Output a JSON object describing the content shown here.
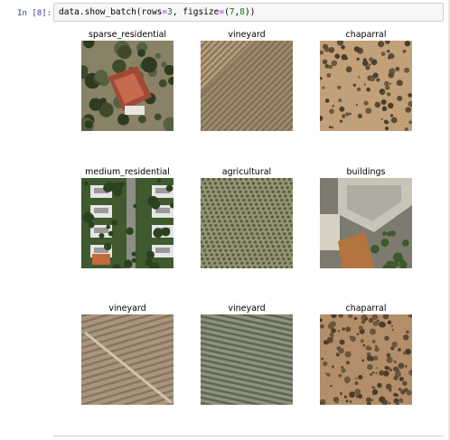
{
  "cell": {
    "prompt": "In [8]:",
    "code_parts": [
      "data.show_batch(rows",
      "=",
      "3",
      ", figsize",
      "=",
      "(",
      "7",
      ",",
      "8",
      "))"
    ]
  },
  "grid": {
    "rows": 3,
    "cols": 3,
    "images": [
      {
        "label": "sparse_residential",
        "kind": "residential-sparse"
      },
      {
        "label": "vineyard",
        "kind": "vineyard-diag"
      },
      {
        "label": "chaparral",
        "kind": "chaparral"
      },
      {
        "label": "medium_residential",
        "kind": "residential-medium"
      },
      {
        "label": "agricultural",
        "kind": "agricultural"
      },
      {
        "label": "buildings",
        "kind": "buildings"
      },
      {
        "label": "vineyard",
        "kind": "vineyard-road"
      },
      {
        "label": "vineyard",
        "kind": "vineyard-rows"
      },
      {
        "label": "chaparral",
        "kind": "chaparral-dense"
      }
    ]
  }
}
